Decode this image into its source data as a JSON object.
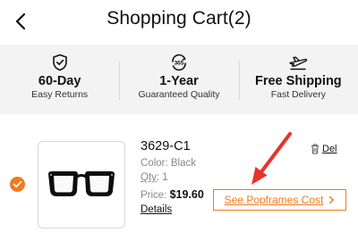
{
  "header": {
    "title": "Shopping Cart",
    "count": "(2)"
  },
  "benefits": [
    {
      "icon": "shield-check-icon",
      "title": "60-Day",
      "subtitle": "Easy Returns"
    },
    {
      "icon": "365-refresh-icon",
      "icon_text": "365",
      "title": "1-Year",
      "subtitle": "Guaranteed Quality"
    },
    {
      "icon": "airplane-icon",
      "title": "Free Shipping",
      "subtitle": "Fast Delivery"
    }
  ],
  "item": {
    "sku": "3629-C1",
    "color": "Color: Black",
    "qty_label": "Qty",
    "qty_value": ": 1",
    "price_label": "Price: ",
    "price_value": "$19.60",
    "details_label": "Details",
    "delete_label": "Del",
    "cost_button_label": "See Popframes Cost",
    "selected": true
  },
  "colors": {
    "accent": "#f07a1f",
    "annotation": "#e8332a",
    "band": "#f3f3f3"
  }
}
